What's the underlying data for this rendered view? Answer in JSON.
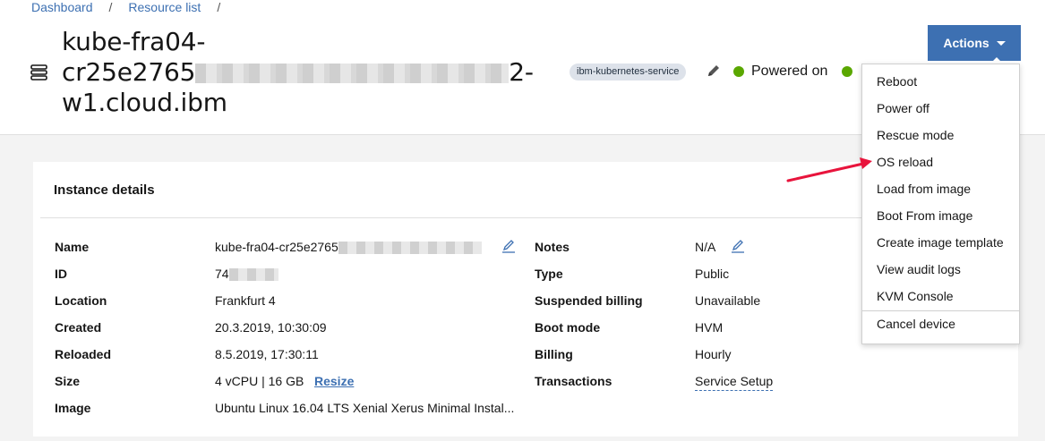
{
  "breadcrumb": {
    "items": [
      "Dashboard",
      "Resource list"
    ],
    "separator": "/"
  },
  "header": {
    "title_lines": [
      "kube-fra04-",
      "cr25e2765",
      "2-",
      "w1.cloud.ibm"
    ],
    "tag": "ibm-kubernetes-service",
    "status": "Powered on",
    "status_color": "#5aa700",
    "actions_label": "Actions",
    "actions_color": "#3d70b2"
  },
  "card": {
    "title": "Instance details",
    "left": [
      {
        "label": "Name",
        "value": "kube-fra04-cr25e2765"
      },
      {
        "label": "ID",
        "value": "74"
      },
      {
        "label": "Location",
        "value": "Frankfurt 4"
      },
      {
        "label": "Created",
        "value": "20.3.2019, 10:30:09"
      },
      {
        "label": "Reloaded",
        "value": "8.5.2019, 17:30:11"
      },
      {
        "label": "Size",
        "value": "4 vCPU | 16 GB",
        "link": "Resize"
      },
      {
        "label": "Image",
        "value": "Ubuntu Linux 16.04 LTS Xenial Xerus Minimal Instal..."
      }
    ],
    "right": [
      {
        "label": "Notes",
        "value": "N/A"
      },
      {
        "label": "Type",
        "value": "Public"
      },
      {
        "label": "Suspended billing",
        "value": "Unavailable"
      },
      {
        "label": "Boot mode",
        "value": "HVM"
      },
      {
        "label": "Billing",
        "value": "Hourly"
      },
      {
        "label": "Transactions",
        "value": "Service Setup"
      }
    ]
  },
  "menu": {
    "items": [
      "Reboot",
      "Power off",
      "Rescue mode",
      "OS reload",
      "Load from image",
      "Boot From image",
      "Create image template",
      "View audit logs",
      "KVM Console"
    ],
    "footer_item": "Cancel device"
  },
  "annotation": {
    "arrow_color": "#e8143c",
    "points_to": "OS reload"
  }
}
